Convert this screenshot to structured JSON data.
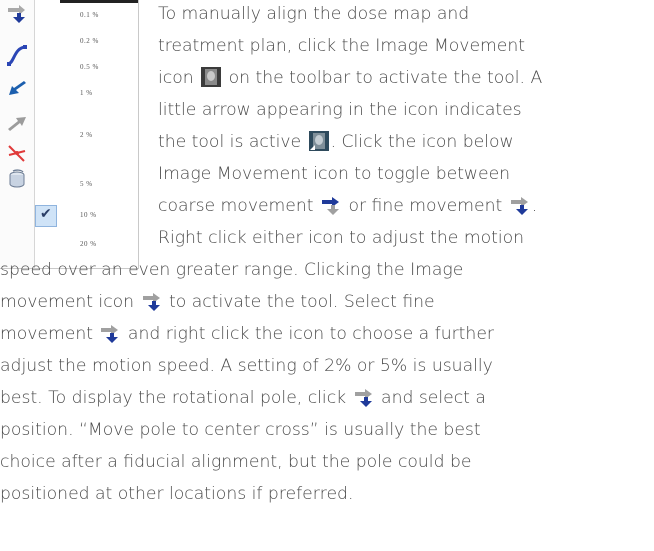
{
  "menu": {
    "speed_options": [
      "0.1 %",
      "0.2 %",
      "0.5 %",
      "1 %",
      "2 %",
      "5 %",
      "10 %",
      "20 %"
    ],
    "selected_option": "10 %",
    "tool_icons": [
      "fine-movement-icon",
      "curve-tool-icon",
      "pan-arrow-icon",
      "gray-arrow-icon",
      "pole-tool-icon",
      "rotate-cylinder-icon"
    ]
  },
  "text": {
    "line1": "To manually align the dose map and",
    "line2": "treatment plan, click the Image Movement",
    "line3a": "icon",
    "line3b": "on the toolbar to activate the tool. A",
    "line4": "little arrow appearing in the icon indicates",
    "line5a": "the tool is active",
    "line5b": ". Click the icon below",
    "line6": "Image Movement icon to toggle between",
    "line7a": "coarse movement",
    "line7b": "or fine movement",
    "line7c": ".",
    "line8": "Right click either icon to adjust the motion",
    "line9": "speed over an even greater range. Clicking the Image",
    "line10a": "movement icon",
    "line10b": "to activate the tool. Select fine",
    "line11a": "movement",
    "line11b": "and right click the icon to choose a further",
    "line12": "adjust the motion speed. A setting of 2% or 5% is usually",
    "line13a": "best. To display the rotational pole, click",
    "line13b": "and select a",
    "line14": "position. “Move pole to center cross” is usually the best",
    "line15": "choice after a fiducial alignment, but the pole could be",
    "line16": "positioned at other locations if preferred."
  },
  "colors": {
    "text": "#4a4a4a",
    "arrow_blue": "#1f3a9a",
    "arrow_gray": "#9a9a9a",
    "selection": "#cfe3f7"
  }
}
